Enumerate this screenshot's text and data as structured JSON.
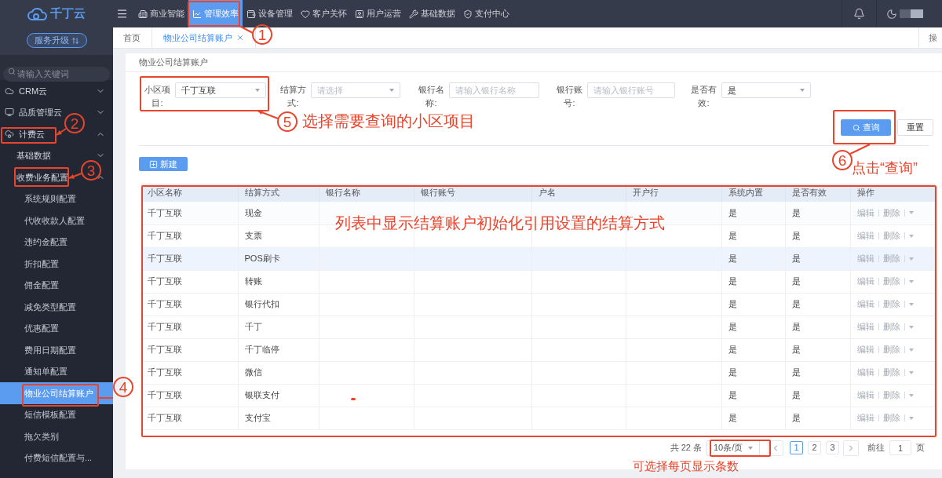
{
  "topbar": {
    "logo": "千丁云",
    "nav": [
      {
        "label": "商业智能",
        "selected": false
      },
      {
        "label": "管理效率",
        "selected": true
      },
      {
        "label": "设备管理",
        "selected": false
      },
      {
        "label": "客户关怀",
        "selected": false
      },
      {
        "label": "用户运营",
        "selected": false
      },
      {
        "label": "基础数据",
        "selected": false
      },
      {
        "label": "支付中心",
        "selected": false
      }
    ]
  },
  "sidebar": {
    "upgrade_button": "服务升级",
    "search": {
      "placeholder": "请输入关键词"
    },
    "items": [
      {
        "label": "CRM云",
        "expanded": false,
        "selected": false
      },
      {
        "label": "品质管理云",
        "expanded": false,
        "selected": false
      },
      {
        "label": "计费云",
        "expanded": true,
        "selected": false,
        "children": [
          {
            "label": "基础数据",
            "expanded": false,
            "selected": false
          },
          {
            "label": "收费业务配置",
            "expanded": true,
            "selected": false,
            "children": [
              {
                "label": "系统规则配置",
                "selected": false
              },
              {
                "label": "代收收款人配置",
                "selected": false
              },
              {
                "label": "违约金配置",
                "selected": false
              },
              {
                "label": "折扣配置",
                "selected": false
              },
              {
                "label": "佣金配置",
                "selected": false
              },
              {
                "label": "减免类型配置",
                "selected": false
              },
              {
                "label": "优惠配置",
                "selected": false
              },
              {
                "label": "费用日期配置",
                "selected": false
              },
              {
                "label": "通知单配置",
                "selected": false
              },
              {
                "label": "物业公司结算账户",
                "selected": true
              },
              {
                "label": "短信模板配置",
                "selected": false
              },
              {
                "label": "拖欠类别",
                "selected": false
              },
              {
                "label": "付费短信配置与...",
                "selected": false
              }
            ]
          }
        ]
      }
    ]
  },
  "tabs": [
    {
      "label": "首页",
      "selected": false,
      "closable": false
    },
    {
      "label": "物业公司结算账户",
      "selected": true,
      "closable": true
    }
  ],
  "tab_bar_action": "操",
  "page": {
    "title": "物业公司结算账户",
    "filters": [
      {
        "label": "小区项目:",
        "kind": "select",
        "value": "千丁互联"
      },
      {
        "label": "结算方式:",
        "kind": "select",
        "placeholder": "请选择"
      },
      {
        "label": "银行名称:",
        "kind": "input",
        "placeholder": "请输入银行名称"
      },
      {
        "label": "银行账号:",
        "kind": "input",
        "placeholder": "请输入银行账号"
      },
      {
        "label": "是否有效:",
        "kind": "select",
        "value": "是"
      }
    ],
    "query_button": "查询",
    "reset_button": "重置",
    "new_button": "新建"
  },
  "table": {
    "columns": [
      "小区名称",
      "结算方式",
      "银行名称",
      "银行账号",
      "户名",
      "开户行",
      "系统内置",
      "是否有效",
      "操作"
    ],
    "rows": [
      {
        "community": "千丁互联",
        "settlement_method": "现金",
        "system_builtin": "是",
        "valid": "是",
        "highlighted": false,
        "actions": [
          {
            "label": "编辑",
            "disabled": true
          },
          {
            "label": "删除",
            "disabled": true
          }
        ]
      },
      {
        "community": "千丁互联",
        "settlement_method": "支票",
        "system_builtin": "是",
        "valid": "是",
        "highlighted": false,
        "actions": [
          {
            "label": "编辑",
            "disabled": true
          },
          {
            "label": "删除",
            "disabled": true
          }
        ]
      },
      {
        "community": "千丁互联",
        "settlement_method": "POS刷卡",
        "system_builtin": "是",
        "valid": "是",
        "highlighted": true,
        "actions": [
          {
            "label": "编辑",
            "disabled": true
          },
          {
            "label": "删除",
            "disabled": true
          }
        ]
      },
      {
        "community": "千丁互联",
        "settlement_method": "转账",
        "system_builtin": "是",
        "valid": "是",
        "highlighted": false,
        "actions": [
          {
            "label": "编辑",
            "disabled": true
          },
          {
            "label": "删除",
            "disabled": true
          }
        ]
      },
      {
        "community": "千丁互联",
        "settlement_method": "银行代扣",
        "system_builtin": "是",
        "valid": "是",
        "highlighted": false,
        "actions": [
          {
            "label": "编辑",
            "disabled": true
          },
          {
            "label": "删除",
            "disabled": true
          }
        ]
      },
      {
        "community": "千丁互联",
        "settlement_method": "千丁",
        "system_builtin": "是",
        "valid": "是",
        "highlighted": false,
        "actions": [
          {
            "label": "编辑",
            "disabled": true
          },
          {
            "label": "删除",
            "disabled": true
          }
        ]
      },
      {
        "community": "千丁互联",
        "settlement_method": "千丁临停",
        "system_builtin": "是",
        "valid": "是",
        "highlighted": false,
        "actions": [
          {
            "label": "编辑",
            "disabled": true
          },
          {
            "label": "删除",
            "disabled": true
          }
        ]
      },
      {
        "community": "千丁互联",
        "settlement_method": "微信",
        "system_builtin": "是",
        "valid": "是",
        "highlighted": false,
        "actions": [
          {
            "label": "编辑",
            "disabled": true
          },
          {
            "label": "删除",
            "disabled": true
          }
        ]
      },
      {
        "community": "千丁互联",
        "settlement_method": "银联支付",
        "system_builtin": "是",
        "valid": "是",
        "highlighted": false,
        "actions": [
          {
            "label": "编辑",
            "disabled": true
          },
          {
            "label": "删除",
            "disabled": true
          }
        ]
      },
      {
        "community": "千丁互联",
        "settlement_method": "支付宝",
        "system_builtin": "是",
        "valid": "是",
        "highlighted": false,
        "actions": [
          {
            "label": "编辑",
            "disabled": true
          },
          {
            "label": "删除",
            "disabled": true
          }
        ]
      }
    ]
  },
  "pagination": {
    "total": "共 22 条",
    "page_size": "10条/页",
    "pages": [
      {
        "label": "1",
        "selected": true
      },
      {
        "label": "2",
        "selected": false
      },
      {
        "label": "3",
        "selected": false
      }
    ],
    "goto_label": "前往",
    "goto_value": "1",
    "goto_suffix": "页"
  },
  "annotations": {
    "markers": [
      "1",
      "2",
      "3",
      "4",
      "5",
      "6"
    ],
    "notes": [
      "选择需要查询的小区项目",
      "点击“查询”",
      "列表中显示结算账户初始化引用设置的结算方式",
      "可选择每页显示条数"
    ]
  }
}
